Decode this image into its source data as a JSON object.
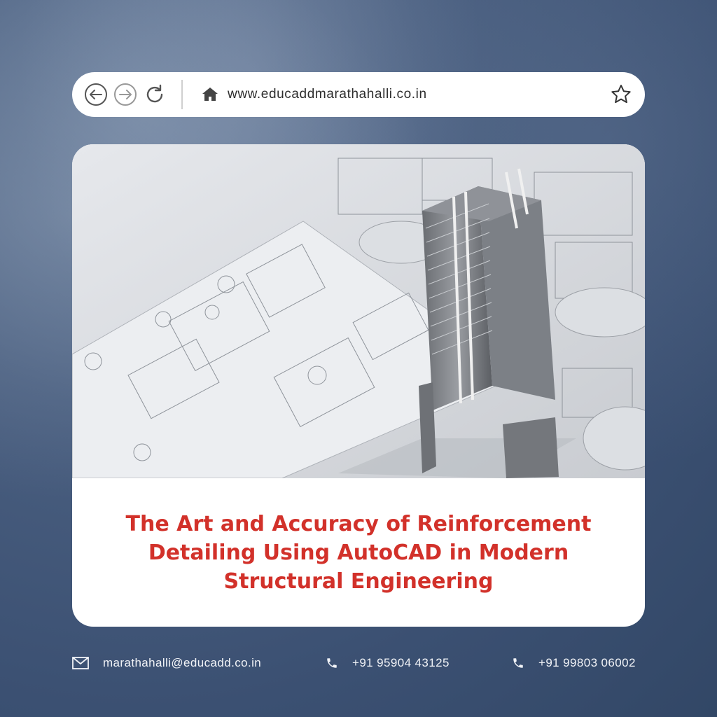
{
  "browser": {
    "url": "www.educaddmarathahalli.co.in",
    "icons": [
      "back-arrow-icon",
      "forward-arrow-icon",
      "reload-icon",
      "home-icon",
      "star-icon"
    ]
  },
  "card": {
    "title": "The Art and Accuracy of Reinforcement Detailing Using AutoCAD in Modern Structural Engineering",
    "title_color": "#d2312a"
  },
  "footer": {
    "email": "marathahalli@educadd.co.in",
    "phone1": "+91 95904 43125",
    "phone2": "+91 99803 06002",
    "icons": [
      "mail-icon",
      "phone-icon",
      "phone-icon"
    ]
  },
  "colors": {
    "background": "#3b5072",
    "card": "#ffffff",
    "accent": "#d2312a"
  }
}
